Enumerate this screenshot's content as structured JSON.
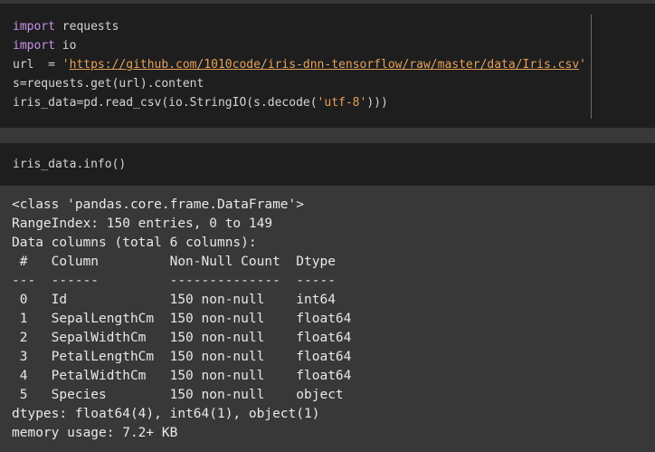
{
  "cell1": {
    "line1": {
      "kw": "import",
      "rest": " requests"
    },
    "line2": {
      "kw": "import",
      "rest": " io"
    },
    "line3": {
      "pre": "url  = ",
      "q1": "'",
      "url": "https://github.com/1010code/iris-dnn-tensorflow/raw/master/data/Iris.csv",
      "q2": "'"
    },
    "line4": "s=requests.get(url).content",
    "line5": {
      "pre": "iris_data=pd.read_csv(io.StringIO(s.decode(",
      "str": "'utf-8'",
      "post": ")))"
    }
  },
  "cell2": {
    "code": "iris_data.info()"
  },
  "output": {
    "class_line": "<class 'pandas.core.frame.DataFrame'>",
    "range_index": "RangeIndex: 150 entries, 0 to 149",
    "columns_summary": "Data columns (total 6 columns):",
    "header": " #   Column         Non-Null Count  Dtype  ",
    "separator": "---  ------         --------------  -----  ",
    "rows": [
      " 0   Id             150 non-null    int64  ",
      " 1   SepalLengthCm  150 non-null    float64",
      " 2   SepalWidthCm   150 non-null    float64",
      " 3   PetalLengthCm  150 non-null    float64",
      " 4   PetalWidthCm   150 non-null    float64",
      " 5   Species        150 non-null    object "
    ],
    "dtypes": "dtypes: float64(4), int64(1), object(1)",
    "memory": "memory usage: 7.2+ KB"
  },
  "colors": {
    "keyword": "#c792ea",
    "string": "#e6a15a",
    "cell_background": "#1e1e1e",
    "output_background": "#383838"
  }
}
